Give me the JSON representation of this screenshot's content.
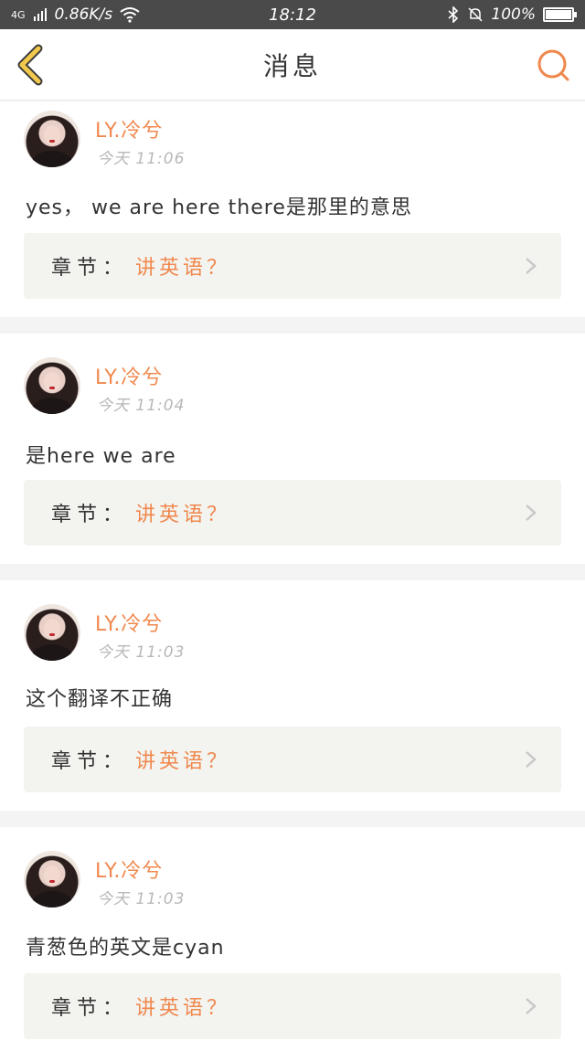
{
  "status_bar": {
    "network": "4G",
    "speed": "0.86K/s",
    "time": "18:12",
    "battery": "100%",
    "battery_level": 1.0
  },
  "nav": {
    "title": "消息"
  },
  "posts": [
    {
      "user": "LY.冷兮",
      "time": "今天 11:06",
      "message": "yes， we are here there是那里的意思",
      "chapter_label": "章节：",
      "chapter_value": "讲英语？"
    },
    {
      "user": "LY.冷兮",
      "time": "今天 11:04",
      "message": "是here we are",
      "chapter_label": "章节：",
      "chapter_value": "讲英语？"
    },
    {
      "user": "LY.冷兮",
      "time": "今天 11:03",
      "message": "这个翻译不正确",
      "chapter_label": "章节：",
      "chapter_value": "讲英语？"
    },
    {
      "user": "LY.冷兮",
      "time": "今天 11:03",
      "message": "青葱色的英文是cyan",
      "chapter_label": "章节：",
      "chapter_value": "讲英语？"
    }
  ],
  "colors": {
    "accent": "#f0884e",
    "back_arrow": "#f2c94c",
    "status_bar": "#4a4a4a"
  }
}
